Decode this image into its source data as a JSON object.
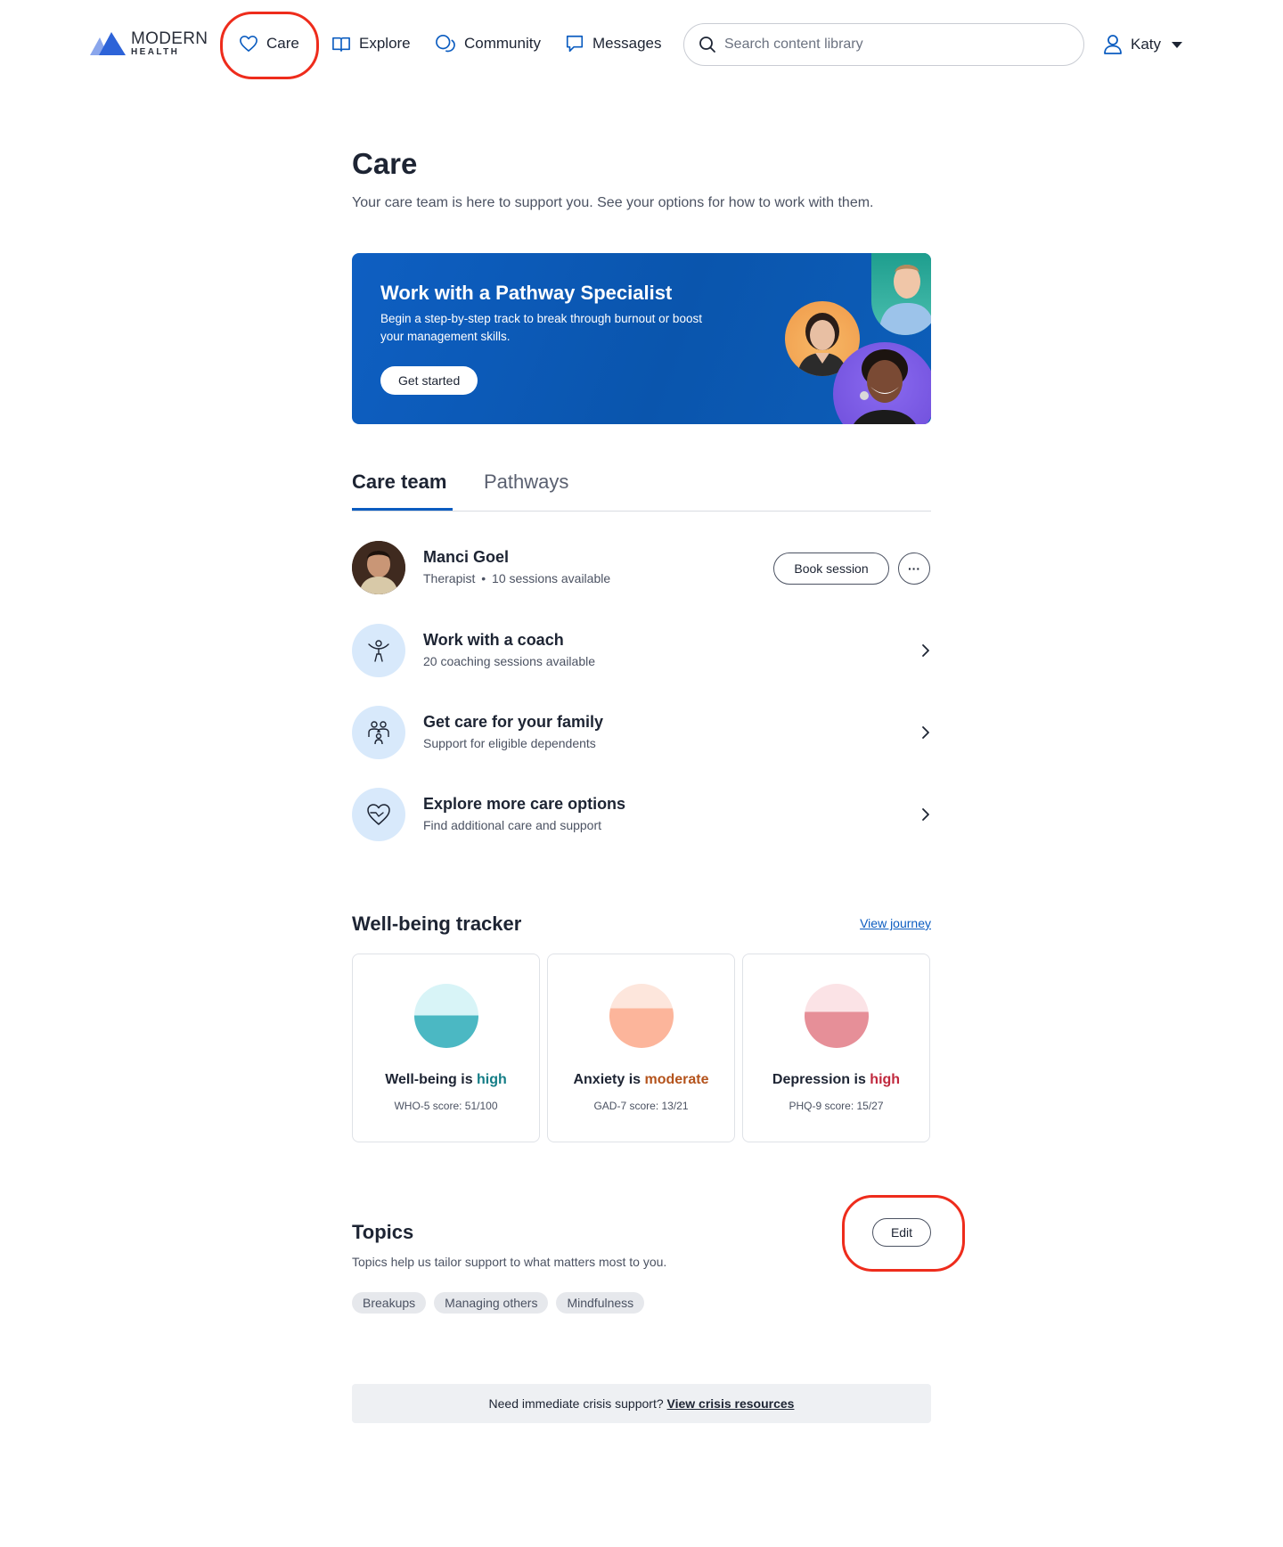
{
  "brand": {
    "line1": "MODERN",
    "line2": "HEALTH"
  },
  "nav": {
    "care": "Care",
    "explore": "Explore",
    "community": "Community",
    "messages": "Messages"
  },
  "search": {
    "placeholder": "Search content library",
    "value": ""
  },
  "user": {
    "name": "Katy"
  },
  "page": {
    "title": "Care",
    "subtitle": "Your care team is here to support you. See your options for how to work with them."
  },
  "banner": {
    "title": "Work with a Pathway Specialist",
    "description": "Begin a step-by-step track to break through burnout or boost your management skills.",
    "button": "Get started"
  },
  "tabs": {
    "care_team": "Care team",
    "pathways": "Pathways",
    "active": "Care team"
  },
  "care_team": {
    "therapist": {
      "name": "Manci Goel",
      "role": "Therapist",
      "separator": "•",
      "sessions": "10 sessions available",
      "book_label": "Book session",
      "more_label": "···"
    },
    "rows": [
      {
        "title": "Work with a coach",
        "subtitle": "20 coaching sessions available",
        "icon": "coach-icon"
      },
      {
        "title": "Get care for your family",
        "subtitle": "Support for eligible dependents",
        "icon": "family-icon"
      },
      {
        "title": "Explore more care options",
        "subtitle": "Find additional care and support",
        "icon": "heart-icon"
      }
    ]
  },
  "wellbeing": {
    "title": "Well-being tracker",
    "link": "View journey",
    "cards": [
      {
        "label": "Well-being is ",
        "level": "high",
        "score": "WHO-5 score: 51/100",
        "level_color": "#137d86",
        "fill_color": "#4bb8c3",
        "bg_color": "#d8f4f7",
        "fill_fraction": 0.51
      },
      {
        "label": "Anxiety is ",
        "level": "moderate",
        "score": "GAD-7 score: 13/21",
        "level_color": "#b4531c",
        "fill_color": "#fcb59b",
        "bg_color": "#fde6dc",
        "fill_fraction": 0.62
      },
      {
        "label": "Depression is ",
        "level": "high",
        "score": "PHQ-9 score: 15/27",
        "level_color": "#c0283d",
        "fill_color": "#e68f98",
        "bg_color": "#fbe3e6",
        "fill_fraction": 0.56
      }
    ]
  },
  "topics": {
    "title": "Topics",
    "edit_label": "Edit",
    "subtitle": "Topics help us tailor support to what matters most to you.",
    "chips": [
      "Breakups",
      "Managing others",
      "Mindfulness"
    ]
  },
  "crisis": {
    "text": "Need immediate crisis support? ",
    "link": "View crisis resources"
  },
  "colors": {
    "accent": "#0b5cc0",
    "annotation": "#ee2c1c",
    "banner": "#0a55ad"
  }
}
